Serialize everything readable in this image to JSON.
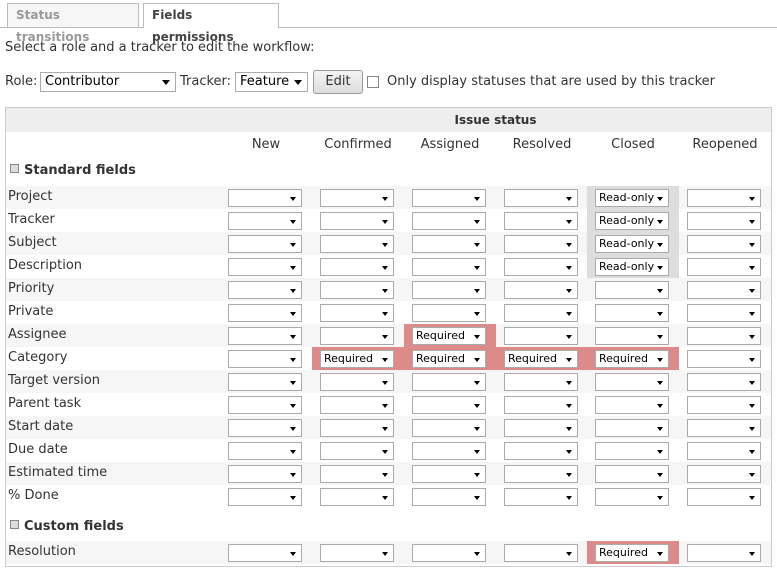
{
  "tabs": [
    {
      "label": "Status transitions",
      "active": false
    },
    {
      "label": "Fields permissions",
      "active": true
    }
  ],
  "intro": "Select a role and a tracker to edit the workflow:",
  "filters": {
    "role_label": "Role:",
    "role_value": "Contributor",
    "tracker_label": "Tracker:",
    "tracker_value": "Feature",
    "edit_button": "Edit",
    "only_used_label": "Only display statuses that are used by this tracker",
    "only_used_checked": false
  },
  "table": {
    "issue_status_header": "Issue status",
    "statuses": [
      "New",
      "Confirmed",
      "Assigned",
      "Resolved",
      "Closed",
      "Reopened"
    ],
    "standard_section": "Standard fields",
    "standard_fields": [
      {
        "name": "Project",
        "values": [
          "",
          "",
          "",
          "",
          "Read-only",
          ""
        ]
      },
      {
        "name": "Tracker",
        "values": [
          "",
          "",
          "",
          "",
          "Read-only",
          ""
        ]
      },
      {
        "name": "Subject",
        "values": [
          "",
          "",
          "",
          "",
          "Read-only",
          ""
        ]
      },
      {
        "name": "Description",
        "values": [
          "",
          "",
          "",
          "",
          "Read-only",
          ""
        ]
      },
      {
        "name": "Priority",
        "values": [
          "",
          "",
          "",
          "",
          "",
          ""
        ]
      },
      {
        "name": "Private",
        "values": [
          "",
          "",
          "",
          "",
          "",
          ""
        ]
      },
      {
        "name": "Assignee",
        "values": [
          "",
          "",
          "Required",
          "",
          "",
          ""
        ]
      },
      {
        "name": "Category",
        "values": [
          "",
          "Required",
          "Required",
          "Required",
          "Required",
          ""
        ]
      },
      {
        "name": "Target version",
        "values": [
          "",
          "",
          "",
          "",
          "",
          ""
        ]
      },
      {
        "name": "Parent task",
        "values": [
          "",
          "",
          "",
          "",
          "",
          ""
        ]
      },
      {
        "name": "Start date",
        "values": [
          "",
          "",
          "",
          "",
          "",
          ""
        ]
      },
      {
        "name": "Due date",
        "values": [
          "",
          "",
          "",
          "",
          "",
          ""
        ]
      },
      {
        "name": "Estimated time",
        "values": [
          "",
          "",
          "",
          "",
          "",
          ""
        ]
      },
      {
        "name": "% Done",
        "values": [
          "",
          "",
          "",
          "",
          "",
          ""
        ]
      }
    ],
    "custom_section": "Custom fields",
    "custom_fields": [
      {
        "name": "Resolution",
        "values": [
          "",
          "",
          "",
          "",
          "Required",
          ""
        ]
      }
    ]
  },
  "colors": {
    "readonly_highlight": "#dddddd",
    "required_highlight": "#dd8a8a"
  }
}
